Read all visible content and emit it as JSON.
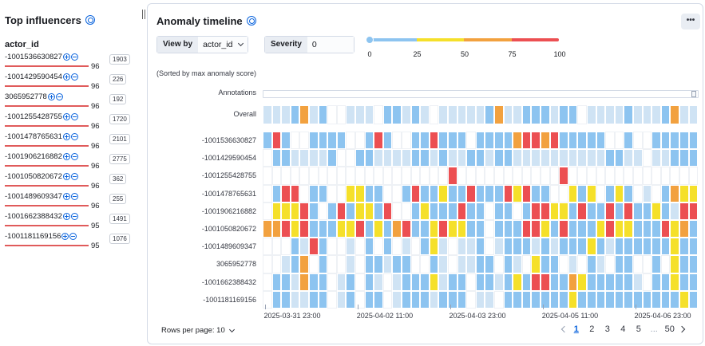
{
  "left": {
    "title": "Top influencers",
    "field_name": "actor_id",
    "influencers": [
      {
        "name": "-1001536630827",
        "score": "96",
        "count": "1903"
      },
      {
        "name": "-1001429590454",
        "score": "96",
        "count": "226"
      },
      {
        "name": "3065952778",
        "score": "96",
        "count": "192"
      },
      {
        "name": "-1001255428755",
        "score": "96",
        "count": "1720"
      },
      {
        "name": "-1001478765631",
        "score": "96",
        "count": "2101"
      },
      {
        "name": "-1001906216882",
        "score": "96",
        "count": "2775"
      },
      {
        "name": "-1001050820672",
        "score": "96",
        "count": "362"
      },
      {
        "name": "-1001489609347",
        "score": "96",
        "count": "255"
      },
      {
        "name": "-1001662388432",
        "score": "95",
        "count": "1491"
      },
      {
        "name": "-1001181169156",
        "score": "95",
        "count": "1076"
      }
    ]
  },
  "timeline": {
    "title": "Anomaly timeline",
    "menu_label": "•••",
    "view_by_label": "View by",
    "view_by_value": "actor_id",
    "severity_label": "Severity",
    "severity_value": "0",
    "severity_ticks": [
      "0",
      "25",
      "50",
      "75",
      "100"
    ],
    "severity_colors": [
      "#8dc4f0",
      "#f5e02a",
      "#f2a13f",
      "#ec4f52"
    ],
    "sorted_note": "(Sorted by max anomaly score)",
    "annotations_label": "Annotations",
    "overall_label": "Overall",
    "x_ticks": [
      "2025-03-31 23:00",
      "2025-04-02 11:00",
      "2025-04-03 23:00",
      "2025-04-05 11:00",
      "2025-04-06 23:00"
    ],
    "rows_per_page_label": "Rows per page: 10",
    "pages": [
      "1",
      "2",
      "3",
      "4",
      "5",
      "...",
      "50"
    ],
    "active_page": "1"
  },
  "legend_colors": {
    "0": "#ffffff",
    "1": "#cfe3f4",
    "2": "#8dc4f0",
    "3": "#f5e02a",
    "4": "#f2a13f",
    "5": "#ec4f52"
  },
  "overall_row": "11124120011102212101111124112221220111121112411",
  "swimlanes": [
    {
      "label": "-1001536630827",
      "cells": "2520022220025200225222022224554522222002002222222"
    },
    {
      "label": "-1001429590454",
      "cells": "0221111200221111221211221221111111111221101122221"
    },
    {
      "label": "-1001255428755",
      "cells": "0000000000000000000050000000000050000000000000000"
    },
    {
      "label": "-1001478765631",
      "cells": "0255022003322002522322522253522003230232010243333"
    },
    {
      "label": "-1001906216882",
      "cells": "0333520252332500232225220220255332522525223215523"
    },
    {
      "label": "-1001050820672",
      "cells": "4453522233523245223533220222553252223533222534222"
    },
    {
      "label": "-1001489609347",
      "cells": "0002152001020201023101120122212122232122222232222"
    },
    {
      "label": "3065952778",
      "cells": "0012402001022122002101122021032201021022002032220"
    },
    {
      "label": "-1001662388432",
      "cells": "0221422012021012223122022123255224322222102232222"
    },
    {
      "label": "-1001181169156",
      "cells": "0221122012022012221222011022222223222222222223222"
    }
  ]
}
